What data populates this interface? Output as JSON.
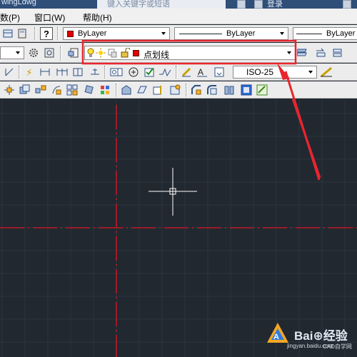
{
  "title_bar": {
    "file_name": "wingLdwg",
    "search_placeholder": "键入关键字或短语",
    "login_label": "登录"
  },
  "menu": {
    "items": [
      "数(P)",
      "窗口(W)",
      "帮助(H)"
    ]
  },
  "properties_toolbar": {
    "color_value": "ByLayer",
    "linetype_value": "ByLayer",
    "lineweight_value": "ByLayer",
    "color_swatch": "#e00000"
  },
  "layer_toolbar": {
    "current_layer": "点划线",
    "layer_color": "#e00000"
  },
  "dimension_toolbar": {
    "dimstyle_value": "ISO-25"
  },
  "annotation": {
    "highlight_color": "#e8252f"
  },
  "watermark": {
    "brand": "Bai⊕经验",
    "url": "jingyan.baidu.com",
    "site": "CAD自学网"
  }
}
